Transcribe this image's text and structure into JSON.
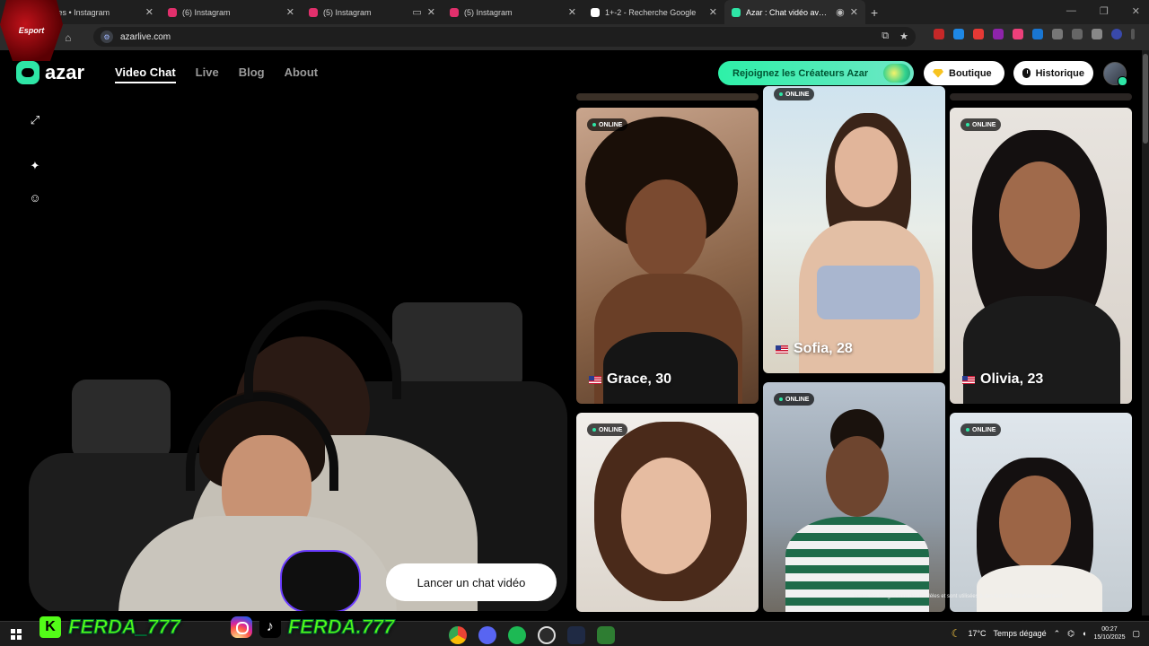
{
  "browser": {
    "tabs": [
      {
        "title": "Stories • Instagram",
        "color": "#e1306c",
        "active": false
      },
      {
        "title": "(6) Instagram",
        "color": "#e1306c",
        "active": false
      },
      {
        "title": "(5) Instagram",
        "color": "#e1306c",
        "active": false
      },
      {
        "title": "(5) Instagram",
        "color": "#e1306c",
        "active": false
      },
      {
        "title": "1+-2 - Recherche Google",
        "color": "#4285f4",
        "active": false
      },
      {
        "title": "Azar : Chat vidéo avec de n",
        "color": "#2ee6a6",
        "active": true
      }
    ],
    "new_tab": "+",
    "url": "azarlive.com"
  },
  "overlay_badge": "Esport",
  "site": {
    "logo_text": "azar",
    "nav": [
      "Video Chat",
      "Live",
      "Blog",
      "About"
    ],
    "creators_cta": "Rejoignez les Créateurs Azar",
    "boutique": "Boutique",
    "historique": "Historique"
  },
  "video": {
    "launch_label": "Lancer un chat vidéo",
    "icons": [
      "expand-icon",
      "sparkle-icon",
      "face-icon"
    ]
  },
  "profiles": [
    {
      "status": "ONLINE",
      "name": "Grace, 30",
      "flag": "us-flag"
    },
    {
      "status": "ONLINE",
      "name": "Sofia, 28",
      "flag": "us-flag"
    },
    {
      "status": "ONLINE",
      "name": "Olivia, 23",
      "flag": "us-flag"
    },
    {
      "status": "ONLINE",
      "name": "",
      "flag": ""
    },
    {
      "status": "ONLINE",
      "name": "",
      "flag": ""
    },
    {
      "status": "ONLINE",
      "name": "",
      "flag": ""
    }
  ],
  "disclaimer": "Toutes les images sont des modèles et sont utilisées à des fins d'illustration uniquement.",
  "stream_overlay": {
    "kick_letter": "K",
    "kick_name": "FERDA_777",
    "tiktok_letter": "♪",
    "insta_name": "FERDA.777"
  },
  "taskbar": {
    "weather": "17°C",
    "weather_text": "Temps dégagé",
    "time": "00:27",
    "date": "15/10/2025"
  }
}
